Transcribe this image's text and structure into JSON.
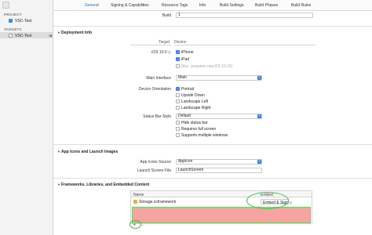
{
  "tabs": [
    "General",
    "Signing & Capabilities",
    "Resource Tags",
    "Info",
    "Build Settings",
    "Build Phases",
    "Build Rules"
  ],
  "sidebar": {
    "project_header": "PROJECT",
    "project_item": "VSC-Test",
    "targets_header": "TARGETS",
    "target_item": "VSC-Test"
  },
  "identity": {
    "build_label": "Build",
    "build_value": "1"
  },
  "deployment": {
    "title": "Deployment Info",
    "col_target": "Target",
    "col_device": "Device",
    "ios_label": "iOS 10.0 ◇",
    "device_iphone": "iPhone",
    "device_ipad": "iPad",
    "device_mac": "Mac",
    "device_mac_note": "(requires macOS 10.15)",
    "main_interface_label": "Main Interface",
    "main_interface_value": "Main",
    "orientation_label": "Device Orientation",
    "orientation_portrait": "Portrait",
    "orientation_upside": "Upside Down",
    "orientation_left": "Landscape Left",
    "orientation_right": "Landscape Right",
    "status_bar_label": "Status Bar Style",
    "status_bar_value": "Default",
    "hide_status_bar": "Hide status bar",
    "requires_full_screen": "Requires full screen",
    "supports_multiple_windows": "Supports multiple windows"
  },
  "icons": {
    "title": "App Icons and Launch Images",
    "app_icons_label": "App Icons Source",
    "app_icons_value": "AppIcon",
    "launch_label": "Launch Screen File",
    "launch_value": "LaunchScreen"
  },
  "frameworks": {
    "title": "Frameworks, Libraries, and Embedded Content",
    "col_name": "Name",
    "col_embed": "Embed",
    "row_name": "Storage.xcframework",
    "row_embed": "Embed & Sign ◇",
    "add_label": "+",
    "remove_label": "–"
  },
  "colors": {
    "accent": "#3b7de8",
    "highlight_red": "#f7a3a1",
    "highlight_green": "#3dc14a"
  }
}
